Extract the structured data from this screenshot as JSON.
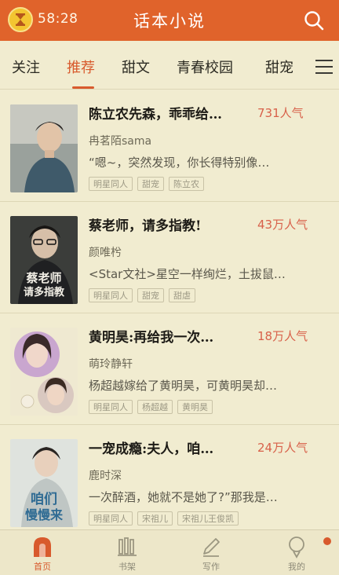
{
  "header": {
    "time": "58:28",
    "title": "话本小说",
    "timer_icon": "sandglass-icon",
    "search_icon": "search-icon"
  },
  "tabs": [
    {
      "label": "关注",
      "active": false
    },
    {
      "label": "推荐",
      "active": true
    },
    {
      "label": "甜文",
      "active": false
    },
    {
      "label": "青春校园",
      "active": false
    },
    {
      "label": "甜宠",
      "active": false
    }
  ],
  "books": [
    {
      "title": "陈立农先森，乖乖给…",
      "popularity": "731人气",
      "author": "冉茗陌sama",
      "desc": "“嗯~，突然发现，你长得特别像…",
      "tags": [
        "明星同人",
        "甜宠",
        "陈立农"
      ]
    },
    {
      "title": "蔡老师，请多指教!",
      "popularity": "43万人气",
      "author": "颜唯枍",
      "desc": "<Star文社>星空一样绚烂，土拔鼠…",
      "tags": [
        "明星同人",
        "甜宠",
        "甜虐"
      ],
      "cover_text": "蔡老师请多指教"
    },
    {
      "title": "黄明昊:再给我一次…",
      "popularity": "18万人气",
      "author": "萌玲静轩",
      "desc": "杨超越嫁给了黄明昊，可黄明昊却…",
      "tags": [
        "明星同人",
        "杨超越",
        "黄明昊"
      ]
    },
    {
      "title": "一宠成瘾:夫人，咱…",
      "popularity": "24万人气",
      "author": "鹿时深",
      "desc": "一次醉酒，她就不是她了?”那我是…",
      "tags": [
        "明星同人",
        "宋祖儿",
        "宋祖儿王俊凯"
      ],
      "cover_text": "咱们慢慢来"
    }
  ],
  "nav": [
    {
      "label": "首页",
      "icon": "home-icon",
      "active": true
    },
    {
      "label": "书架",
      "icon": "bookshelf-icon",
      "active": false
    },
    {
      "label": "写作",
      "icon": "pen-icon",
      "active": false
    },
    {
      "label": "我的",
      "icon": "profile-icon",
      "active": false
    }
  ],
  "colors": {
    "accent": "#e0632b",
    "background": "#f1ecd0",
    "popularity": "#d8614a"
  }
}
